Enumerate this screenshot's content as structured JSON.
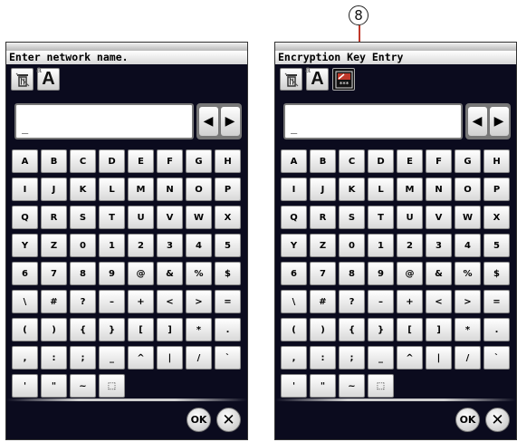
{
  "callout": "8",
  "left": {
    "title": "Enter network name.",
    "entry": "_",
    "toolbar": [
      "delete-icon",
      "font-toggle-icon"
    ]
  },
  "right": {
    "title": "Encryption Key Entry",
    "entry": "_",
    "toolbar": [
      "delete-icon",
      "font-toggle-icon",
      "hide-key-icon"
    ]
  },
  "arrows": {
    "left": "◀",
    "right": "▶"
  },
  "keys": [
    "A",
    "B",
    "C",
    "D",
    "E",
    "F",
    "G",
    "H",
    "I",
    "J",
    "K",
    "L",
    "M",
    "N",
    "O",
    "P",
    "Q",
    "R",
    "S",
    "T",
    "U",
    "V",
    "W",
    "X",
    "Y",
    "Z",
    "0",
    "1",
    "2",
    "3",
    "4",
    "5",
    "6",
    "7",
    "8",
    "9",
    "@",
    "&",
    "%",
    "$",
    "\\",
    "#",
    "?",
    "–",
    "+",
    "<",
    ">",
    "=",
    "(",
    ")",
    "{",
    "}",
    "[",
    "]",
    "*",
    ".",
    ",",
    ":",
    ";",
    "_",
    "^",
    "|",
    "/",
    "`",
    "'",
    "\"",
    "~",
    "⬚"
  ],
  "buttons": {
    "ok": "OK",
    "cancel": "✕"
  },
  "colors": {
    "screen_bg": "#0b0b1e",
    "key_face": "#ffffff",
    "callout_line": "#c0392b"
  }
}
